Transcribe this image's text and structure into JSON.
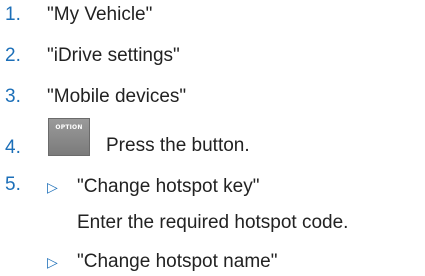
{
  "steps": [
    {
      "num": "1.",
      "text": "\"My Vehicle\""
    },
    {
      "num": "2.",
      "text": "\"iDrive settings\""
    },
    {
      "num": "3.",
      "text": "\"Mobile devices\""
    },
    {
      "num": "4.",
      "text": "Press the button.",
      "button_label": "OPTION"
    },
    {
      "num": "5."
    }
  ],
  "sub_items": [
    {
      "bullet": "▷",
      "text": "\"Change hotspot key\"",
      "note": "Enter the required hotspot code."
    },
    {
      "bullet": "▷",
      "text": "\"Change hotspot name\""
    }
  ],
  "colors": {
    "accent": "#1c6fb8",
    "text": "#222222",
    "button": "#8a8a8a"
  }
}
